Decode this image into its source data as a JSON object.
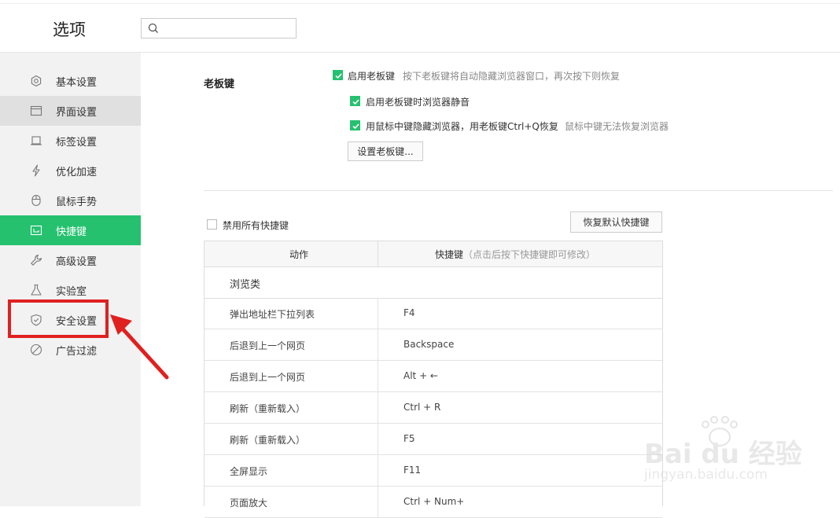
{
  "header": {
    "title": "选项",
    "search": {
      "value": "",
      "placeholder": "",
      "icon": "search-icon"
    }
  },
  "sidebar": {
    "items": [
      {
        "label": "基本设置",
        "icon": "gear-icon",
        "state": "normal"
      },
      {
        "label": "界面设置",
        "icon": "window-icon",
        "state": "hover"
      },
      {
        "label": "标签设置",
        "icon": "tab-icon",
        "state": "normal"
      },
      {
        "label": "优化加速",
        "icon": "lightning-icon",
        "state": "normal"
      },
      {
        "label": "鼠标手势",
        "icon": "mouse-icon",
        "state": "normal"
      },
      {
        "label": "快捷键",
        "icon": "keyboard-icon",
        "state": "active"
      },
      {
        "label": "高级设置",
        "icon": "wrench-icon",
        "state": "normal"
      },
      {
        "label": "实验室",
        "icon": "flask-icon",
        "state": "normal"
      },
      {
        "label": "安全设置",
        "icon": "shield-icon",
        "state": "normal"
      },
      {
        "label": "广告过滤",
        "icon": "block-icon",
        "state": "normal"
      }
    ]
  },
  "boss_key": {
    "title": "老板键",
    "enable": {
      "label": "启用老板键",
      "checked": true,
      "hint": "按下老板键将自动隐藏浏览器窗口，再次按下则恢复"
    },
    "mute": {
      "label": "启用老板键时浏览器静音",
      "checked": true
    },
    "middle_click": {
      "label": "用鼠标中键隐藏浏览器，用老板键Ctrl+Q恢复",
      "checked": true,
      "hint": "鼠标中键无法恢复浏览器"
    },
    "set_button": "设置老板键..."
  },
  "shortcuts": {
    "disable_all": {
      "label": "禁用所有快捷键",
      "checked": false
    },
    "restore_button": "恢复默认快捷键",
    "headers": {
      "action": "动作",
      "key": "快捷键",
      "key_note": "（点击后按下快捷键即可修改）"
    },
    "group": "浏览类",
    "rows": [
      {
        "action": "弹出地址栏下拉列表",
        "key": "F4"
      },
      {
        "action": "后退到上一个网页",
        "key": "Backspace"
      },
      {
        "action": "后退到上一个网页",
        "key": "Alt + ←"
      },
      {
        "action": "刷新（重新载入）",
        "key": "Ctrl + R"
      },
      {
        "action": "刷新（重新载入）",
        "key": "F5"
      },
      {
        "action": "全屏显示",
        "key": "F11"
      },
      {
        "action": "页面放大",
        "key": "Ctrl + Num+"
      }
    ]
  },
  "annotation": {
    "color": "#e02020"
  },
  "watermark": {
    "logo": "Bai du 经验",
    "url": "jingyan.baidu.com"
  },
  "colors": {
    "accent": "#25c16f",
    "annotation": "#e02020"
  }
}
